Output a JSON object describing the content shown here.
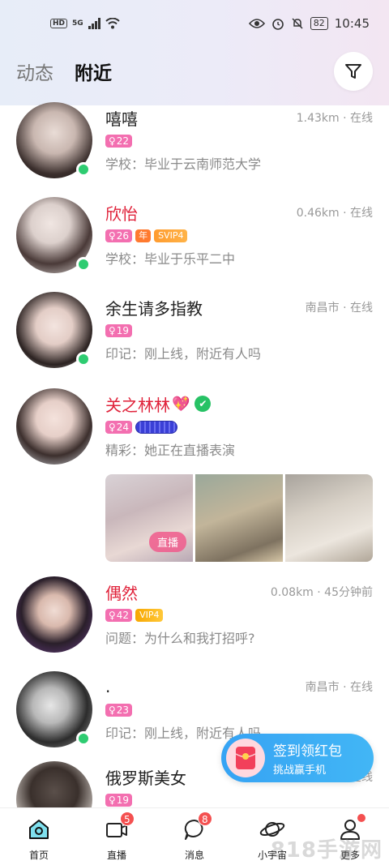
{
  "status_bar": {
    "network_badge": "HD",
    "signal": "5G",
    "battery": "82",
    "time": "10:45"
  },
  "header": {
    "tabs": [
      {
        "label": "动态",
        "active": false
      },
      {
        "label": "附近",
        "active": true
      }
    ]
  },
  "users": [
    {
      "name": "嘻嘻",
      "meta": "1.43km · 在线",
      "age": "22",
      "desc": "学校：毕业于云南师范大学",
      "online": true
    },
    {
      "name": "欣怡",
      "meta": "0.46km · 在线",
      "age": "26",
      "nian": "年",
      "vip": "SVIP4",
      "desc": "学校：毕业于乐平二中",
      "online": true
    },
    {
      "name": "余生请多指教",
      "meta": "南昌市 · 在线",
      "age": "19",
      "desc": "印记：刚上线，附近有人吗",
      "online": true
    },
    {
      "name": "关之林林",
      "heart": "💖",
      "verified": "✔",
      "age": "24",
      "desc": "精彩：她正在直播表演",
      "live_label": "直播"
    },
    {
      "name": "偶然",
      "meta": "0.08km · 45分钟前",
      "age": "42",
      "vip": "VIP4",
      "desc": "问题：为什么和我打招呼?",
      "online": false
    },
    {
      "name": ".",
      "meta": "南昌市 · 在线",
      "age": "23",
      "desc": "印记：刚上线，附近有人吗",
      "online": true
    },
    {
      "name": "俄罗斯美女",
      "meta": "南昌市 · 在线",
      "age": "19"
    }
  ],
  "red_packet": {
    "title": "签到领红包",
    "subtitle": "挑战赢手机"
  },
  "bottom_nav": [
    {
      "label": "首页",
      "active": true
    },
    {
      "label": "直播",
      "badge": "5"
    },
    {
      "label": "消息",
      "badge": "8"
    },
    {
      "label": "小宇宙"
    },
    {
      "label": "更多"
    }
  ],
  "watermark": "818手游网",
  "colors": {
    "online": "#2ecc71",
    "name_red": "#e0223a",
    "age_tag": "#f36fb0",
    "accent_blue": "#36a3f4",
    "badge_red": "#f45050"
  }
}
